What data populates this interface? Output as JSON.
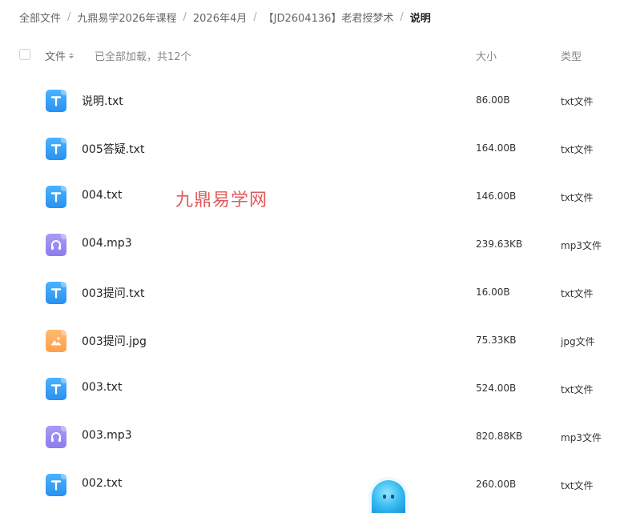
{
  "breadcrumb": {
    "items": [
      "全部文件",
      "九鼎易学2026年课程",
      "2026年4月",
      "【JD2604136】老君授梦术"
    ],
    "current": "说明",
    "separator": "/"
  },
  "header": {
    "name_label": "文件",
    "loaded_note": "已全部加载，共12个",
    "size_label": "大小",
    "type_label": "类型"
  },
  "files": [
    {
      "name": "说明.txt",
      "size": "86.00B",
      "type": "txt文件",
      "icon": "txt-file-icon"
    },
    {
      "name": "005答疑.txt",
      "size": "164.00B",
      "type": "txt文件",
      "icon": "txt-file-icon"
    },
    {
      "name": "004.txt",
      "size": "146.00B",
      "type": "txt文件",
      "icon": "txt-file-icon"
    },
    {
      "name": "004.mp3",
      "size": "239.63KB",
      "type": "mp3文件",
      "icon": "audio-file-icon"
    },
    {
      "name": "003提问.txt",
      "size": "16.00B",
      "type": "txt文件",
      "icon": "txt-file-icon"
    },
    {
      "name": "003提问.jpg",
      "size": "75.33KB",
      "type": "jpg文件",
      "icon": "image-file-icon"
    },
    {
      "name": "003.txt",
      "size": "524.00B",
      "type": "txt文件",
      "icon": "txt-file-icon"
    },
    {
      "name": "003.mp3",
      "size": "820.88KB",
      "type": "mp3文件",
      "icon": "audio-file-icon"
    },
    {
      "name": "002.txt",
      "size": "260.00B",
      "type": "txt文件",
      "icon": "txt-file-icon"
    }
  ],
  "watermark": "九鼎易学网",
  "colors": {
    "txt_icon": "#3aa2f8",
    "mp3_icon": "#9a8cf3",
    "jpg_icon": "#ffab5a",
    "watermark": "#e05a5a"
  }
}
